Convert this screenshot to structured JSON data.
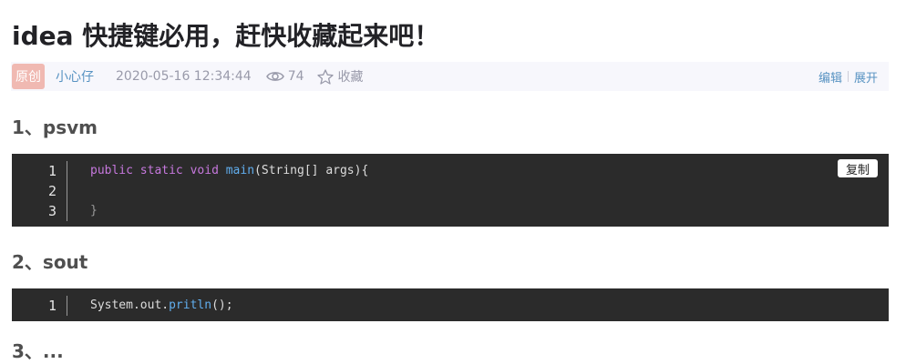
{
  "article": {
    "title": "idea 快捷键必用，赶快收藏起来吧！"
  },
  "meta": {
    "badge": "原创",
    "author": "小心仔",
    "datetime": "2020-05-16 12:34:44",
    "views": "74",
    "favorite_label": "收藏",
    "edit_label": "编辑",
    "expand_label": "展开",
    "colors": {
      "badge_bg": "#f0b9b2",
      "link": "#5893c2",
      "meta_bg": "#f7f7fc"
    },
    "icons": {
      "views": "eye-icon",
      "favorite": "star-icon"
    }
  },
  "sections": [
    {
      "heading": "1、psvm",
      "copy_label": "复制",
      "line_numbers": [
        "1",
        "2",
        "3"
      ],
      "code": {
        "l1_kw1": "public",
        "l1_kw2": "static",
        "l1_kw3": "void",
        "l1_fn": "main",
        "l1_rest": "(String[] args){",
        "l3": "}"
      }
    },
    {
      "heading": "2、sout",
      "line_numbers": [
        "1"
      ],
      "code": {
        "l1_a": "System.out.",
        "l1_fn": "pritln",
        "l1_b": "();"
      }
    }
  ],
  "next_heading_partial": "3、..."
}
